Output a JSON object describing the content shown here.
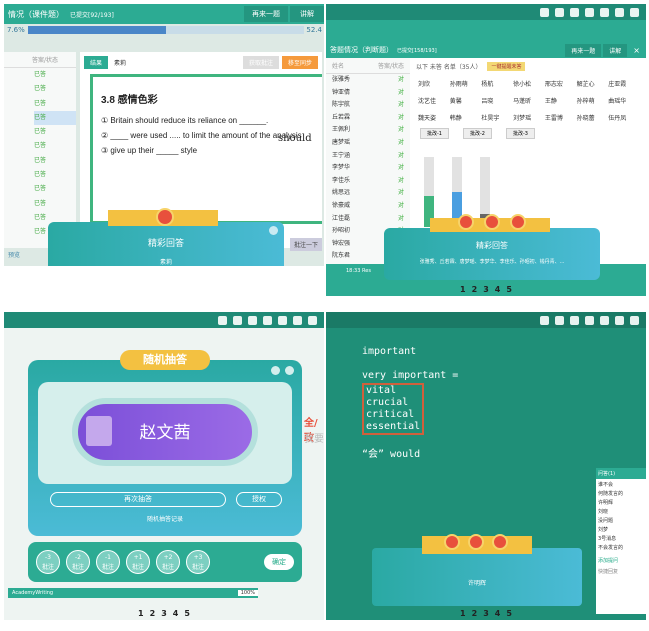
{
  "panel1": {
    "title": "情况（课件题）",
    "teacher": "已提交[92/193]",
    "btn_next": "再来一题",
    "btn_explain": "讲解",
    "progress_left": "7.6%",
    "progress_right": "52.4",
    "progress_value": 0.5,
    "tab_result": "结果",
    "tab_name": "素莉",
    "tag_label": "答案/状态",
    "status": "已答",
    "q_title": "3.8 感情色彩",
    "items": [
      "① Britain should reduce its reliance on ______.",
      "② ____ were used ..... to limit the amount of the analysis",
      "③ give up their _____ style"
    ],
    "handwriting": "should",
    "card_title": "精彩回答",
    "card_name": "素莉",
    "footer": "预览",
    "btn_redo": "批注一下",
    "btn_grey": "获取批注",
    "btn_orange": "移至同步"
  },
  "panel2": {
    "title": "答题情况（判断题）",
    "teacher": "已提交[158/193]",
    "btn_next": "再来一题",
    "btn_explain": "讲解",
    "list_header": [
      "姓名",
      "答案/状态"
    ],
    "students": [
      "张雅秀",
      "钟亚倩",
      "陈宇航",
      "丘若霖",
      "王佩利",
      "唐梦瑶",
      "王宁涵",
      "李梦华",
      "李佳乐",
      "姚思远",
      "徐豪威",
      "江佳磊",
      "孙昭初",
      "钟宏强",
      "阮东君"
    ],
    "answer": "对",
    "tabs": "以下 未答 名单（35人）",
    "tab_hint": "一键提醒未答",
    "grid": [
      "刘欣",
      "孙雨萌",
      "杨航",
      "徐小松",
      "邢志宏",
      "解芷心",
      "庄亚霞",
      "沈艺佳",
      "黄馨",
      "吕晓",
      "马蓬昕",
      "王静",
      "孙梓萌",
      "曲瑶华",
      "魏天姿",
      "韩静",
      "杜昊宇",
      "刘梦瑶",
      "王雷博",
      "孙晓蕾",
      "伍丹凤"
    ],
    "grid_btns": [
      "批改-1",
      "批改-2",
      "批改-3"
    ],
    "bars": [
      0.45,
      0.5,
      0.18
    ],
    "card_title": "精彩回答",
    "card_names": "张雅秀、丘若霖、唐梦瑶、李梦华、李佳乐、孙昭初、钱丹青、...",
    "time": "18:33 Res"
  },
  "pages": [
    "1",
    "2",
    "3",
    "4",
    "5"
  ],
  "panel3": {
    "title": "随机抽答",
    "name": "赵文茜",
    "btn_again": "再次抽答",
    "btn_auth": "授权",
    "records": "随机抽答记录",
    "scores": [
      {
        "v": "-3",
        "l": "批注"
      },
      {
        "v": "-2",
        "l": "批注"
      },
      {
        "v": "-1",
        "l": "批注"
      },
      {
        "v": "+1",
        "l": "批注"
      },
      {
        "v": "+2",
        "l": "批注"
      },
      {
        "v": "+3",
        "l": "批注"
      }
    ],
    "confirm": "确定",
    "brand": "AcademyWriting",
    "zoom": "100%",
    "side_red": "全/政",
    "side_grey": "我要"
  },
  "panel4": {
    "line1": "important",
    "line2": "very important =",
    "words": [
      "vital",
      "crucial",
      "critical",
      "essential"
    ],
    "line3": "“会” would",
    "card_name": "许明辉",
    "side_title": "问答(1)",
    "msgs": [
      "谁不会",
      "何随发言的",
      "许明辉",
      "刘晓",
      "没问题",
      "刘梦",
      "3号消息",
      "不会发言的"
    ],
    "side_btn": "添加提问",
    "side_label": "快捷回复"
  }
}
